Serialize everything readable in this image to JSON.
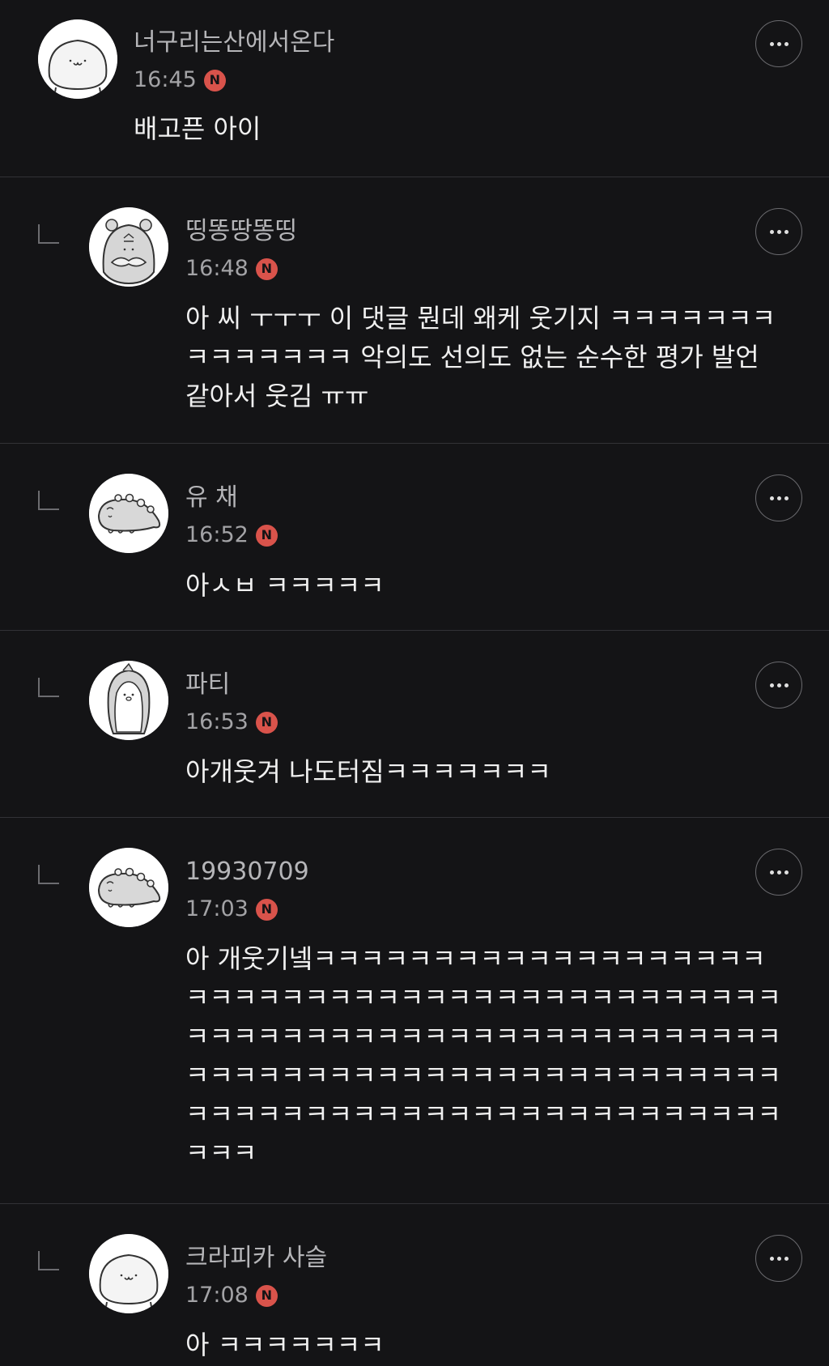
{
  "comments": [
    {
      "nickname": "너구리는산에서온다",
      "time": "16:45",
      "badge": "N",
      "text": "배고픈 아이",
      "is_reply": false,
      "avatar": "white-blob-character"
    },
    {
      "nickname": "띵똥땅똥띵",
      "time": "16:48",
      "badge": "N",
      "text": "아 씨 ㅜㅜㅜ 이 댓글 뭔데 왜케 웃기지 ㅋㅋㅋㅋㅋㅋㅋ ㅋㅋㅋㅋㅋㅋㅋ 악의도 선의도 없는 순수한 평가 발언 같아서 웃김 ㅠㅠ",
      "is_reply": true,
      "avatar": "bear-with-mustache"
    },
    {
      "nickname": "유 채",
      "time": "16:52",
      "badge": "N",
      "text": "아ㅅㅂ ㅋㅋㅋㅋㅋ",
      "is_reply": true,
      "avatar": "lying-dinosaur"
    },
    {
      "nickname": "파티",
      "time": "16:53",
      "badge": "N",
      "text": "아개웃겨 나도터짐ㅋㅋㅋㅋㅋㅋㅋ",
      "is_reply": true,
      "avatar": "penguin-character"
    },
    {
      "nickname": "19930709",
      "time": "17:03",
      "badge": "N",
      "text": "아 개웃기넼ㅋㅋㅋㅋㅋㅋㅋㅋㅋㅋㅋㅋㅋㅋㅋㅋㅋㅋㅋㅋㅋㅋㅋㅋㅋㅋㅋㅋㅋㅋㅋㅋㅋㅋㅋㅋㅋㅋㅋㅋㅋㅋㅋㅋㅋㅋㅋㅋㅋㅋㅋㅋㅋㅋㅋㅋㅋㅋㅋㅋㅋㅋㅋㅋㅋㅋㅋㅋㅋㅋㅋㅋㅋㅋㅋㅋㅋㅋㅋㅋㅋㅋㅋㅋㅋㅋㅋㅋㅋㅋㅋㅋㅋㅋㅋㅋㅋㅋㅋㅋㅋㅋㅋㅋㅋㅋㅋㅋㅋㅋㅋㅋㅋㅋㅋㅋㅋㅋㅋㅋㅋㅋ",
      "is_reply": true,
      "avatar": "lying-dinosaur"
    },
    {
      "nickname": "크라피카 사슬",
      "time": "17:08",
      "badge": "N",
      "text": "아 ㅋㅋㅋㅋㅋㅋㅋ",
      "is_reply": true,
      "avatar": "white-blob-character"
    }
  ],
  "colors": {
    "background": "#141416",
    "divider": "#323236",
    "nickname": "#b5b5b8",
    "time": "#a3a3a6",
    "text": "#f0f0f0",
    "new_badge": "#d9534b"
  }
}
